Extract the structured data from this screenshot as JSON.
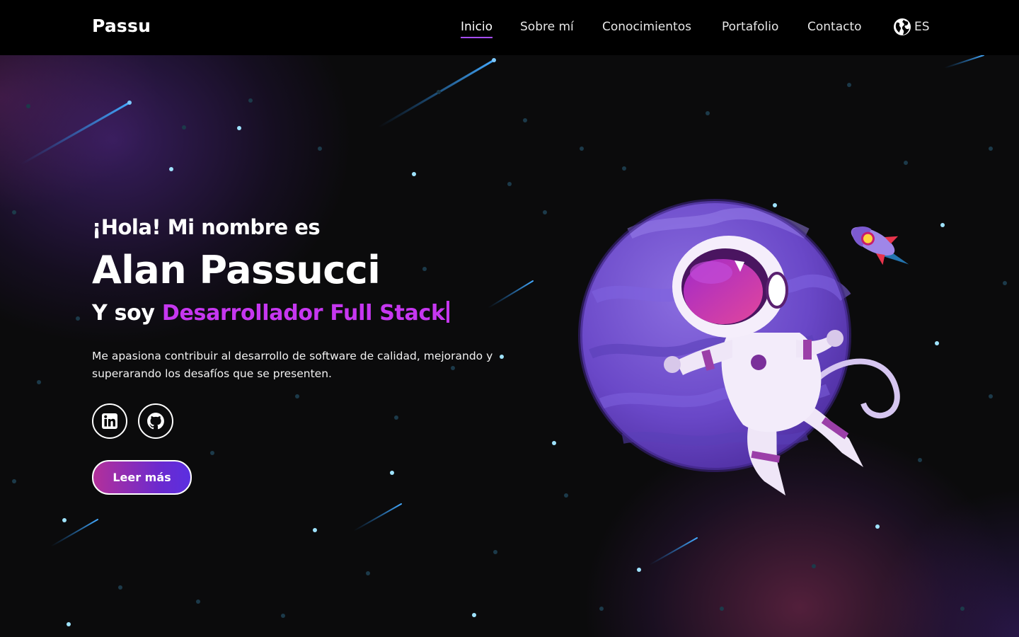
{
  "nav": {
    "brand": "Passu",
    "items": [
      {
        "label": "Inicio",
        "active": true
      },
      {
        "label": "Sobre mí"
      },
      {
        "label": "Conocimientos"
      },
      {
        "label": "Portafolio"
      },
      {
        "label": "Contacto"
      }
    ],
    "language": {
      "icon": "globe-icon",
      "label": "ES"
    }
  },
  "hero": {
    "greeting": "¡Hola! Mi nombre es",
    "name": "Alan Passucci",
    "role_prefix": "Y soy",
    "role_highlight": "Desarrollador Full Stack",
    "description": "Me apasiona contribuir al desarrollo de software de calidad, mejorando y superarando los desafíos que se presenten.",
    "social": [
      {
        "icon": "linkedin-icon"
      },
      {
        "icon": "github-icon"
      }
    ],
    "cta_label": "Leer más"
  },
  "colors": {
    "accent": "#c637f0",
    "nav_underline": "#a64dff",
    "background": "#0b0b0c",
    "button_gradient": [
      "#b3309a",
      "#5b2fe0"
    ]
  }
}
